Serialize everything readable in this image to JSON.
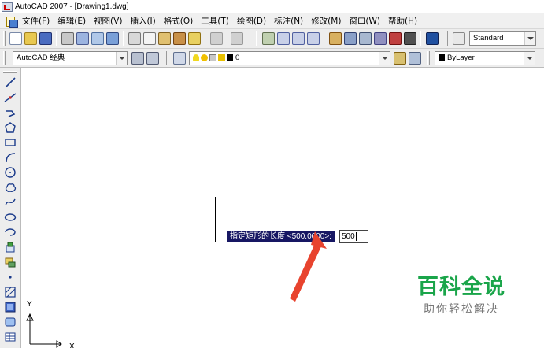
{
  "window": {
    "title": "AutoCAD 2007 - [Drawing1.dwg]"
  },
  "menu": {
    "items": [
      "文件(F)",
      "编辑(E)",
      "视图(V)",
      "插入(I)",
      "格式(O)",
      "工具(T)",
      "绘图(D)",
      "标注(N)",
      "修改(M)",
      "窗口(W)",
      "帮助(H)"
    ]
  },
  "toolbar": {
    "text_style": "Standard",
    "workspace": "AutoCAD 经典",
    "layer": "0",
    "color": "ByLayer"
  },
  "command": {
    "prompt": "指定矩形的长度 <500.0000>:",
    "input_value": "500"
  },
  "ucs": {
    "y_label": "Y",
    "x_label": "X"
  },
  "watermark": {
    "main": "百科全说",
    "sub": "助你轻松解决"
  },
  "colors": {
    "prompt_bg": "#171763",
    "arrow": "#e8432e",
    "watermark_green": "#1aa54a"
  },
  "left_tools": [
    "line-icon",
    "construction-line-icon",
    "polyline-icon",
    "polygon-icon",
    "rectangle-icon",
    "arc-icon",
    "circle-icon",
    "revision-cloud-icon",
    "spline-icon",
    "ellipse-icon",
    "ellipse-arc-icon",
    "insert-block-icon",
    "make-block-icon",
    "point-icon",
    "hatch-icon",
    "gradient-icon",
    "region-icon",
    "table-icon"
  ]
}
